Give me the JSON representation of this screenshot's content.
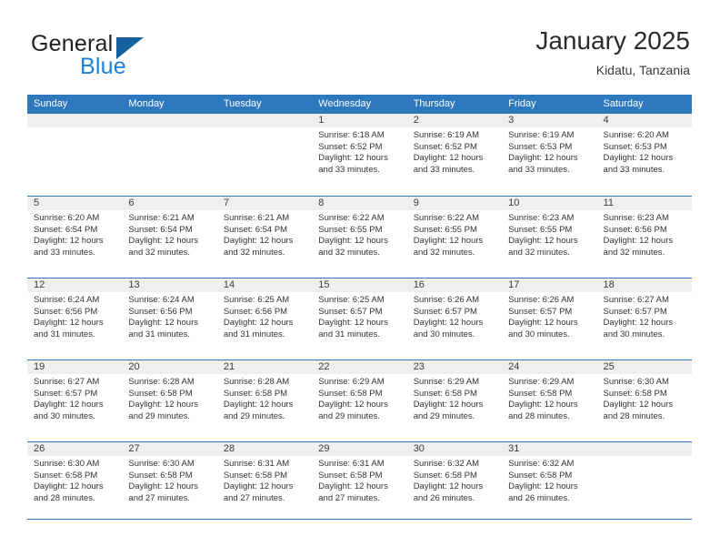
{
  "brand": {
    "name_top": "General",
    "name_bottom": "Blue",
    "accent_color": "#1b7fd4",
    "triangle_color": "#15619f"
  },
  "header": {
    "month_title": "January 2025",
    "location": "Kidatu, Tanzania"
  },
  "calendar": {
    "header_bg": "#2e78bd",
    "daynum_band_bg": "#efefef",
    "weekdays": [
      "Sunday",
      "Monday",
      "Tuesday",
      "Wednesday",
      "Thursday",
      "Friday",
      "Saturday"
    ],
    "weeks": [
      [
        {
          "day": "",
          "sunrise": "",
          "sunset": "",
          "daylight_line1": "",
          "daylight_line2": "",
          "empty": true
        },
        {
          "day": "",
          "sunrise": "",
          "sunset": "",
          "daylight_line1": "",
          "daylight_line2": "",
          "empty": true
        },
        {
          "day": "",
          "sunrise": "",
          "sunset": "",
          "daylight_line1": "",
          "daylight_line2": "",
          "empty": true
        },
        {
          "day": "1",
          "sunrise": "Sunrise: 6:18 AM",
          "sunset": "Sunset: 6:52 PM",
          "daylight_line1": "Daylight: 12 hours",
          "daylight_line2": "and 33 minutes."
        },
        {
          "day": "2",
          "sunrise": "Sunrise: 6:19 AM",
          "sunset": "Sunset: 6:52 PM",
          "daylight_line1": "Daylight: 12 hours",
          "daylight_line2": "and 33 minutes."
        },
        {
          "day": "3",
          "sunrise": "Sunrise: 6:19 AM",
          "sunset": "Sunset: 6:53 PM",
          "daylight_line1": "Daylight: 12 hours",
          "daylight_line2": "and 33 minutes."
        },
        {
          "day": "4",
          "sunrise": "Sunrise: 6:20 AM",
          "sunset": "Sunset: 6:53 PM",
          "daylight_line1": "Daylight: 12 hours",
          "daylight_line2": "and 33 minutes."
        }
      ],
      [
        {
          "day": "5",
          "sunrise": "Sunrise: 6:20 AM",
          "sunset": "Sunset: 6:54 PM",
          "daylight_line1": "Daylight: 12 hours",
          "daylight_line2": "and 33 minutes."
        },
        {
          "day": "6",
          "sunrise": "Sunrise: 6:21 AM",
          "sunset": "Sunset: 6:54 PM",
          "daylight_line1": "Daylight: 12 hours",
          "daylight_line2": "and 32 minutes."
        },
        {
          "day": "7",
          "sunrise": "Sunrise: 6:21 AM",
          "sunset": "Sunset: 6:54 PM",
          "daylight_line1": "Daylight: 12 hours",
          "daylight_line2": "and 32 minutes."
        },
        {
          "day": "8",
          "sunrise": "Sunrise: 6:22 AM",
          "sunset": "Sunset: 6:55 PM",
          "daylight_line1": "Daylight: 12 hours",
          "daylight_line2": "and 32 minutes."
        },
        {
          "day": "9",
          "sunrise": "Sunrise: 6:22 AM",
          "sunset": "Sunset: 6:55 PM",
          "daylight_line1": "Daylight: 12 hours",
          "daylight_line2": "and 32 minutes."
        },
        {
          "day": "10",
          "sunrise": "Sunrise: 6:23 AM",
          "sunset": "Sunset: 6:55 PM",
          "daylight_line1": "Daylight: 12 hours",
          "daylight_line2": "and 32 minutes."
        },
        {
          "day": "11",
          "sunrise": "Sunrise: 6:23 AM",
          "sunset": "Sunset: 6:56 PM",
          "daylight_line1": "Daylight: 12 hours",
          "daylight_line2": "and 32 minutes."
        }
      ],
      [
        {
          "day": "12",
          "sunrise": "Sunrise: 6:24 AM",
          "sunset": "Sunset: 6:56 PM",
          "daylight_line1": "Daylight: 12 hours",
          "daylight_line2": "and 31 minutes."
        },
        {
          "day": "13",
          "sunrise": "Sunrise: 6:24 AM",
          "sunset": "Sunset: 6:56 PM",
          "daylight_line1": "Daylight: 12 hours",
          "daylight_line2": "and 31 minutes."
        },
        {
          "day": "14",
          "sunrise": "Sunrise: 6:25 AM",
          "sunset": "Sunset: 6:56 PM",
          "daylight_line1": "Daylight: 12 hours",
          "daylight_line2": "and 31 minutes."
        },
        {
          "day": "15",
          "sunrise": "Sunrise: 6:25 AM",
          "sunset": "Sunset: 6:57 PM",
          "daylight_line1": "Daylight: 12 hours",
          "daylight_line2": "and 31 minutes."
        },
        {
          "day": "16",
          "sunrise": "Sunrise: 6:26 AM",
          "sunset": "Sunset: 6:57 PM",
          "daylight_line1": "Daylight: 12 hours",
          "daylight_line2": "and 30 minutes."
        },
        {
          "day": "17",
          "sunrise": "Sunrise: 6:26 AM",
          "sunset": "Sunset: 6:57 PM",
          "daylight_line1": "Daylight: 12 hours",
          "daylight_line2": "and 30 minutes."
        },
        {
          "day": "18",
          "sunrise": "Sunrise: 6:27 AM",
          "sunset": "Sunset: 6:57 PM",
          "daylight_line1": "Daylight: 12 hours",
          "daylight_line2": "and 30 minutes."
        }
      ],
      [
        {
          "day": "19",
          "sunrise": "Sunrise: 6:27 AM",
          "sunset": "Sunset: 6:57 PM",
          "daylight_line1": "Daylight: 12 hours",
          "daylight_line2": "and 30 minutes."
        },
        {
          "day": "20",
          "sunrise": "Sunrise: 6:28 AM",
          "sunset": "Sunset: 6:58 PM",
          "daylight_line1": "Daylight: 12 hours",
          "daylight_line2": "and 29 minutes."
        },
        {
          "day": "21",
          "sunrise": "Sunrise: 6:28 AM",
          "sunset": "Sunset: 6:58 PM",
          "daylight_line1": "Daylight: 12 hours",
          "daylight_line2": "and 29 minutes."
        },
        {
          "day": "22",
          "sunrise": "Sunrise: 6:29 AM",
          "sunset": "Sunset: 6:58 PM",
          "daylight_line1": "Daylight: 12 hours",
          "daylight_line2": "and 29 minutes."
        },
        {
          "day": "23",
          "sunrise": "Sunrise: 6:29 AM",
          "sunset": "Sunset: 6:58 PM",
          "daylight_line1": "Daylight: 12 hours",
          "daylight_line2": "and 29 minutes."
        },
        {
          "day": "24",
          "sunrise": "Sunrise: 6:29 AM",
          "sunset": "Sunset: 6:58 PM",
          "daylight_line1": "Daylight: 12 hours",
          "daylight_line2": "and 28 minutes."
        },
        {
          "day": "25",
          "sunrise": "Sunrise: 6:30 AM",
          "sunset": "Sunset: 6:58 PM",
          "daylight_line1": "Daylight: 12 hours",
          "daylight_line2": "and 28 minutes."
        }
      ],
      [
        {
          "day": "26",
          "sunrise": "Sunrise: 6:30 AM",
          "sunset": "Sunset: 6:58 PM",
          "daylight_line1": "Daylight: 12 hours",
          "daylight_line2": "and 28 minutes."
        },
        {
          "day": "27",
          "sunrise": "Sunrise: 6:30 AM",
          "sunset": "Sunset: 6:58 PM",
          "daylight_line1": "Daylight: 12 hours",
          "daylight_line2": "and 27 minutes."
        },
        {
          "day": "28",
          "sunrise": "Sunrise: 6:31 AM",
          "sunset": "Sunset: 6:58 PM",
          "daylight_line1": "Daylight: 12 hours",
          "daylight_line2": "and 27 minutes."
        },
        {
          "day": "29",
          "sunrise": "Sunrise: 6:31 AM",
          "sunset": "Sunset: 6:58 PM",
          "daylight_line1": "Daylight: 12 hours",
          "daylight_line2": "and 27 minutes."
        },
        {
          "day": "30",
          "sunrise": "Sunrise: 6:32 AM",
          "sunset": "Sunset: 6:58 PM",
          "daylight_line1": "Daylight: 12 hours",
          "daylight_line2": "and 26 minutes."
        },
        {
          "day": "31",
          "sunrise": "Sunrise: 6:32 AM",
          "sunset": "Sunset: 6:58 PM",
          "daylight_line1": "Daylight: 12 hours",
          "daylight_line2": "and 26 minutes."
        },
        {
          "day": "",
          "sunrise": "",
          "sunset": "",
          "daylight_line1": "",
          "daylight_line2": "",
          "empty": true
        }
      ]
    ]
  }
}
